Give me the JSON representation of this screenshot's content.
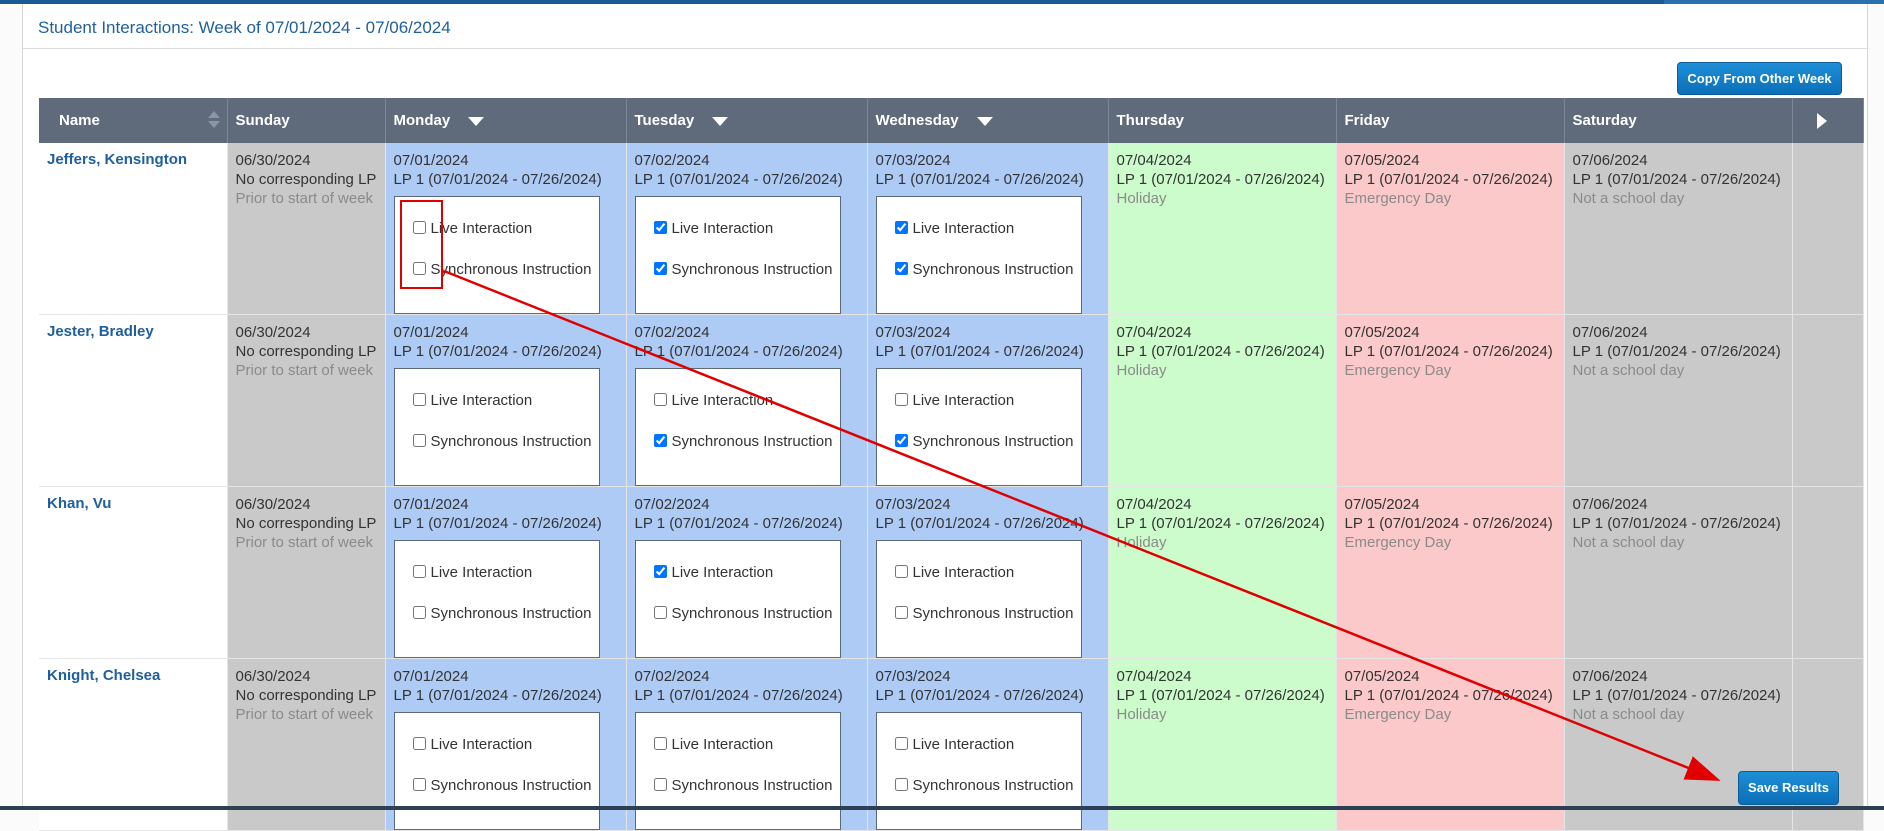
{
  "panel": {
    "title": "Student Interactions: Week of 07/01/2024 - 07/06/2024"
  },
  "buttons": {
    "copy_label": "Copy From Other Week",
    "save_label": "Save Results"
  },
  "headers": [
    "Name",
    "Sunday",
    "Monday",
    "Tuesday",
    "Wednesday",
    "Thursday",
    "Friday",
    "Saturday"
  ],
  "labels": {
    "live": "Live Interaction",
    "sync": "Synchronous Instruction"
  },
  "days": {
    "sun": {
      "date": "06/30/2024",
      "lp": "No corresponding LP",
      "note": "Prior to start of week"
    },
    "mon": {
      "date": "07/01/2024",
      "lp": "LP 1 (07/01/2024 - 07/26/2024)"
    },
    "tue": {
      "date": "07/02/2024",
      "lp": "LP 1 (07/01/2024 - 07/26/2024)"
    },
    "wed": {
      "date": "07/03/2024",
      "lp": "LP 1 (07/01/2024 - 07/26/2024)"
    },
    "thu": {
      "date": "07/04/2024",
      "lp": "LP 1 (07/01/2024 - 07/26/2024)",
      "note": "Holiday"
    },
    "fri": {
      "date": "07/05/2024",
      "lp": "LP 1 (07/01/2024 - 07/26/2024)",
      "note": "Emergency Day"
    },
    "sat": {
      "date": "07/06/2024",
      "lp": "LP 1 (07/01/2024 - 07/26/2024)",
      "note": "Not a school day"
    }
  },
  "students": [
    {
      "name": "Jeffers, Kensington",
      "mon": {
        "live": false,
        "sync": false
      },
      "tue": {
        "live": true,
        "sync": true
      },
      "wed": {
        "live": true,
        "sync": true
      }
    },
    {
      "name": "Jester, Bradley",
      "mon": {
        "live": false,
        "sync": false
      },
      "tue": {
        "live": false,
        "sync": true
      },
      "wed": {
        "live": false,
        "sync": true
      }
    },
    {
      "name": "Khan, Vu",
      "mon": {
        "live": false,
        "sync": false
      },
      "tue": {
        "live": true,
        "sync": false
      },
      "wed": {
        "live": false,
        "sync": false
      }
    },
    {
      "name": "Knight, Chelsea",
      "mon": {
        "live": false,
        "sync": false
      },
      "tue": {
        "live": false,
        "sync": false
      },
      "wed": {
        "live": false,
        "sync": false
      }
    }
  ],
  "colors": {
    "accent": "#1f5f9e",
    "header_bg": "#5f6b7a",
    "past_day": "#c9c9c9",
    "school_day": "#aecbf6",
    "holiday": "#ccfccc",
    "emergency": "#fbc9c9",
    "annotation": "#e00000"
  }
}
